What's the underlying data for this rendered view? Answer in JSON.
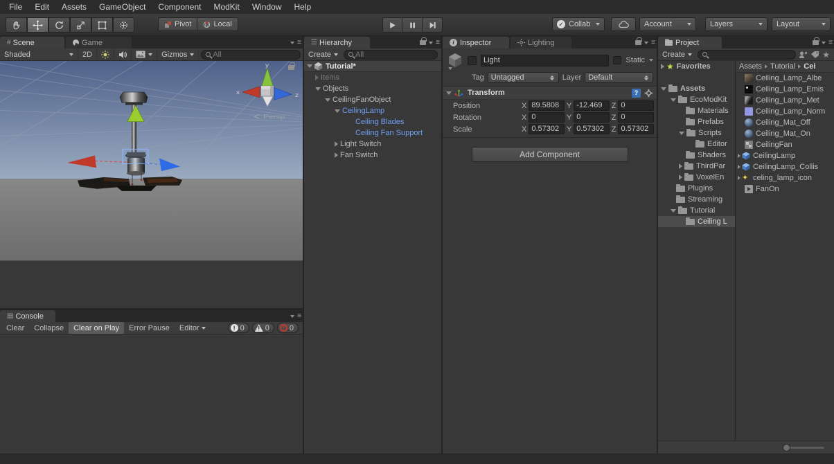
{
  "menubar": {
    "items": [
      "File",
      "Edit",
      "Assets",
      "GameObject",
      "Component",
      "ModKit",
      "Window",
      "Help"
    ]
  },
  "toolbar": {
    "pivot_label": "Pivot",
    "local_label": "Local",
    "collab_label": "Collab",
    "account_label": "Account",
    "layers_label": "Layers",
    "layout_label": "Layout"
  },
  "scene_panel": {
    "tabs": [
      {
        "label": "Scene"
      },
      {
        "label": "Game"
      }
    ],
    "shaded_label": "Shaded",
    "two_d_label": "2D",
    "gizmos_label": "Gizmos",
    "search_placeholder": "All",
    "persp_label": "Persp",
    "gizmo_axes": {
      "x": "x",
      "y": "y",
      "z": "z"
    }
  },
  "hierarchy_panel": {
    "tab_label": "Hierarchy",
    "create_label": "Create",
    "search_placeholder": "All",
    "scene_row": {
      "label": "Tutorial*"
    },
    "items": [
      {
        "label": "Items"
      },
      {
        "label": "Objects"
      },
      {
        "label": "CeilingFanObject"
      },
      {
        "label": "CeilingLamp"
      },
      {
        "label": "Ceiling Blades"
      },
      {
        "label": "Ceiling Fan Support"
      },
      {
        "label": "Light Switch"
      },
      {
        "label": "Fan Switch"
      }
    ]
  },
  "inspector_panel": {
    "tabs": [
      {
        "label": "Inspector"
      },
      {
        "label": "Lighting"
      }
    ],
    "header": {
      "name_value": "Light",
      "static_label": "Static",
      "tag_label": "Tag",
      "tag_value": "Untagged",
      "layer_label": "Layer",
      "layer_value": "Default"
    },
    "transform": {
      "title": "Transform",
      "axis_labels": {
        "x": "X",
        "y": "Y",
        "z": "Z"
      },
      "rows": [
        {
          "label": "Position",
          "x": "89.5808",
          "y": "-12.469",
          "z": "0"
        },
        {
          "label": "Rotation",
          "x": "0",
          "y": "0",
          "z": "0"
        },
        {
          "label": "Scale",
          "x": "0.57302",
          "y": "0.57302",
          "z": "0.57302"
        }
      ]
    },
    "add_component_label": "Add Component"
  },
  "project_panel": {
    "tab_label": "Project",
    "create_label": "Create",
    "breadcrumb": [
      {
        "label": "Assets"
      },
      {
        "label": "Tutorial"
      },
      {
        "label": "Cei"
      }
    ],
    "tree": [
      {
        "label": "Favorites"
      },
      {
        "label": "Assets"
      },
      {
        "label": "EcoModKit"
      },
      {
        "label": "Materials"
      },
      {
        "label": "Prefabs"
      },
      {
        "label": "Scripts"
      },
      {
        "label": "Editor"
      },
      {
        "label": "Shaders"
      },
      {
        "label": "ThirdPar"
      },
      {
        "label": "VoxelEn"
      },
      {
        "label": "Plugins"
      },
      {
        "label": "Streaming"
      },
      {
        "label": "Tutorial"
      },
      {
        "label": "Ceiling L"
      }
    ],
    "files": [
      {
        "label": "Ceiling_Lamp_Albe"
      },
      {
        "label": "Ceiling_Lamp_Emis"
      },
      {
        "label": "Ceiling_Lamp_Met"
      },
      {
        "label": "Ceiling_Lamp_Norm"
      },
      {
        "label": "Ceiling_Mat_Off"
      },
      {
        "label": "Ceiling_Mat_On"
      },
      {
        "label": "CeilingFan"
      },
      {
        "label": "CeilingLamp"
      },
      {
        "label": "CeilingLamp_Collis"
      },
      {
        "label": "celing_lamp_icon"
      },
      {
        "label": "FanOn"
      }
    ]
  },
  "console_panel": {
    "tab_label": "Console",
    "buttons": [
      "Clear",
      "Collapse",
      "Clear on Play",
      "Error Pause"
    ],
    "editor_label": "Editor",
    "counts": {
      "info": "0",
      "warning": "0",
      "error": "0"
    }
  },
  "colors": {
    "prefab_text_blue": "#6e9ef0",
    "selection_grey": "#4c4c4c",
    "axis_red": "#c0392b",
    "axis_green": "#86c43d",
    "axis_blue": "#3468d6"
  }
}
